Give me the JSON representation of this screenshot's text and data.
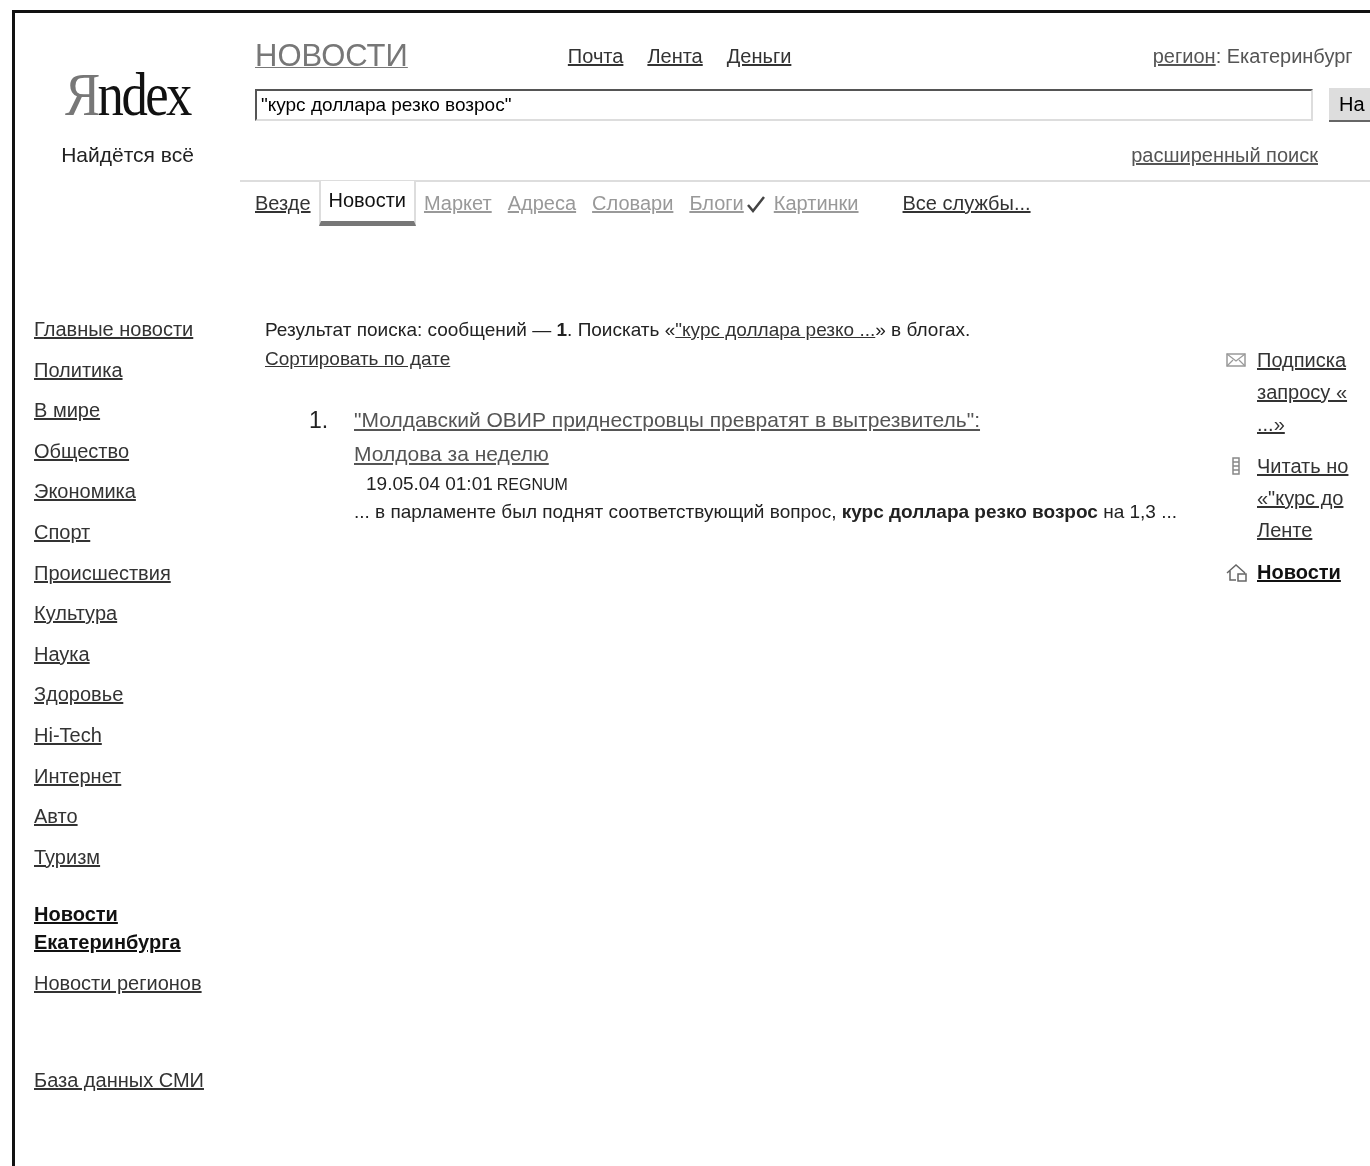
{
  "logo": {
    "text": "Яndex",
    "tagline": "Найдётся всё"
  },
  "section_title": "НОВОСТИ",
  "top_links": [
    "Почта",
    "Лента",
    "Деньги"
  ],
  "region": {
    "label": "регион",
    "separator": ":",
    "value": "Екатеринбург"
  },
  "search": {
    "value": "\"курс доллара резко возрос\"",
    "button": "На",
    "advanced": "расширенный поиск"
  },
  "tabs": [
    {
      "label": "Везде",
      "selected": false,
      "dim": false,
      "checked": false
    },
    {
      "label": "Новости",
      "selected": true,
      "dim": false,
      "checked": false
    },
    {
      "label": "Маркет",
      "selected": false,
      "dim": true,
      "checked": false
    },
    {
      "label": "Адреса",
      "selected": false,
      "dim": true,
      "checked": false
    },
    {
      "label": "Словари",
      "selected": false,
      "dim": true,
      "checked": false
    },
    {
      "label": "Блоги",
      "selected": false,
      "dim": true,
      "checked": true
    },
    {
      "label": "Картинки",
      "selected": false,
      "dim": true,
      "checked": false
    }
  ],
  "all_services": "Все службы...",
  "sidebar": {
    "sections": [
      {
        "items": [
          {
            "label": "Главные новости",
            "bold": false
          },
          {
            "label": "Политика",
            "bold": false
          },
          {
            "label": "В мире",
            "bold": false
          },
          {
            "label": "Общество",
            "bold": false
          },
          {
            "label": "Экономика",
            "bold": false
          },
          {
            "label": "Спорт",
            "bold": false
          },
          {
            "label": "Происшествия",
            "bold": false
          },
          {
            "label": "Культура",
            "bold": false
          },
          {
            "label": "Наука",
            "bold": false
          },
          {
            "label": "Здоровье",
            "bold": false
          },
          {
            "label": "Hi-Tech",
            "bold": false
          },
          {
            "label": "Интернет",
            "bold": false
          },
          {
            "label": "Авто",
            "bold": false
          },
          {
            "label": "Туризм",
            "bold": false
          }
        ]
      },
      {
        "items": [
          {
            "label": "Новости Екатеринбурга",
            "bold": true
          },
          {
            "label": "Новости регионов",
            "bold": false
          }
        ]
      },
      {
        "items": [
          {
            "label": "База данных СМИ",
            "bold": false
          }
        ]
      }
    ]
  },
  "summary": {
    "before": "Результат поиска: сообщений — **1**. Поискать «",
    "link": "\"курс доллара резко ...",
    "after": "» в блогах."
  },
  "sort_link": "Сортировать по дате",
  "results": [
    {
      "number": "1.",
      "title": "\"Молдавский ОВИР приднестровцы превратят в вытрезвитель\": Молдова за неделю",
      "date": "19.05.04 01:01",
      "source": "REGNUM",
      "snippet": "... в парламенте был поднят соответствующий вопрос, **курс доллара резко возрос** на 1,3 ..."
    }
  ],
  "side_links": [
    {
      "kind": "mail",
      "lines": [
        "Подписка",
        "запросу «",
        "...»"
      ],
      "bold": false
    },
    {
      "kind": "feed",
      "lines": [
        "Читать но",
        "«\"курс до",
        "Ленте"
      ],
      "bold": false
    },
    {
      "kind": "home",
      "lines": [
        "Новости"
      ],
      "bold": true
    }
  ]
}
